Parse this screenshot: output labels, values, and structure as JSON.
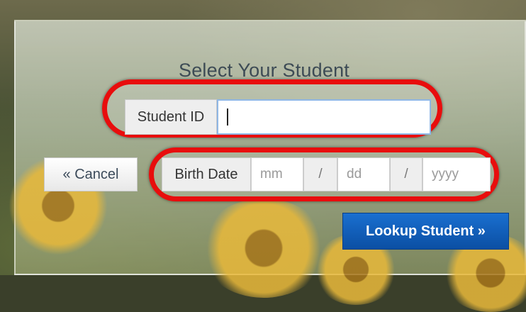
{
  "form": {
    "title": "Select Your Student",
    "student_id_label": "Student ID",
    "student_id_value": "",
    "birth_date_label": "Birth Date",
    "month_placeholder": "mm",
    "separator_1": "/",
    "day_placeholder": "dd",
    "separator_2": "/",
    "year_placeholder": "yyyy",
    "cancel_label": "« Cancel",
    "lookup_label": "Lookup Student »"
  },
  "colors": {
    "highlight": "#e80d0d",
    "primary_button": "#0b4fa3"
  }
}
